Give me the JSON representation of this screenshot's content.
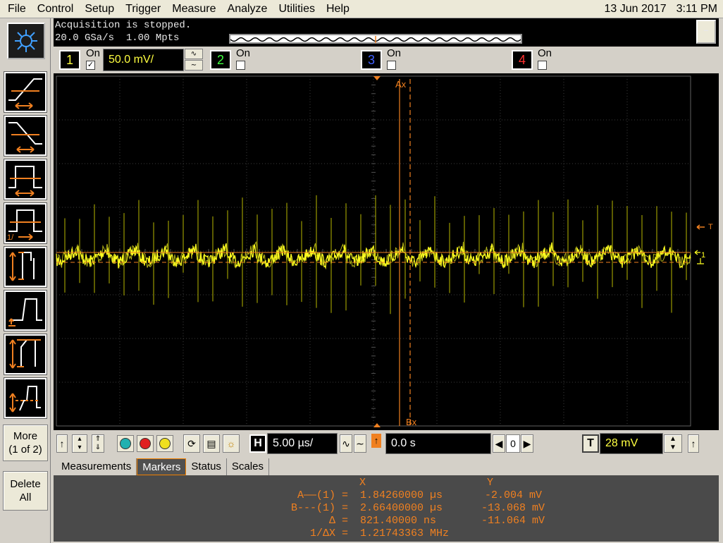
{
  "menu": [
    "File",
    "Control",
    "Setup",
    "Trigger",
    "Measure",
    "Analyze",
    "Utilities",
    "Help"
  ],
  "datetime": {
    "date": "13 Jun 2017",
    "time": "3:11 PM"
  },
  "acquisition": {
    "status": "Acquisition is stopped.",
    "sample_rate": "20.0 GSa/s",
    "points": "1.00 Mpts"
  },
  "minimize_label": "–",
  "channels": [
    {
      "num": "1",
      "on_label": "On",
      "checked": "✓",
      "color": "#ffff40",
      "scale": "50.0 mV/"
    },
    {
      "num": "2",
      "on_label": "On",
      "checked": "",
      "color": "#40ff40"
    },
    {
      "num": "3",
      "on_label": "On",
      "checked": "",
      "color": "#4060ff"
    },
    {
      "num": "4",
      "on_label": "On",
      "checked": "",
      "color": "#ff3030"
    }
  ],
  "sidebar": {
    "more_label": "More",
    "more_sub": "(1 of 2)",
    "delete_label": "Delete",
    "delete_sub": "All"
  },
  "graticule": {
    "marker_a_label": "Ax",
    "marker_b_label": "Bx",
    "trigger_label": "T",
    "ground_label": "1"
  },
  "controls": {
    "h_label": "H",
    "timebase": "5.00 µs/",
    "delay": "0.0 s",
    "delay_step": "0",
    "t_label": "T",
    "trigger_level": "28 mV"
  },
  "tabs": [
    "Measurements",
    "Markers",
    "Status",
    "Scales"
  ],
  "active_tab": "Markers",
  "markers": {
    "x_header": "X",
    "y_header": "Y",
    "rows": [
      {
        "label": "A——(1) =",
        "x": "1.84260000 µs",
        "y": "-2.004 mV"
      },
      {
        "label": "B---(1) =",
        "x": "2.66400000 µs",
        "y": "-13.068 mV"
      },
      {
        "label": "Δ =",
        "x": "821.40000 ns",
        "y": "-11.064 mV"
      },
      {
        "label": "1/ΔX =",
        "x": "1.21743363 MHz",
        "y": ""
      }
    ]
  },
  "colors": {
    "trace": "#ffff20",
    "marker": "#f08020",
    "grid": "#505050"
  }
}
